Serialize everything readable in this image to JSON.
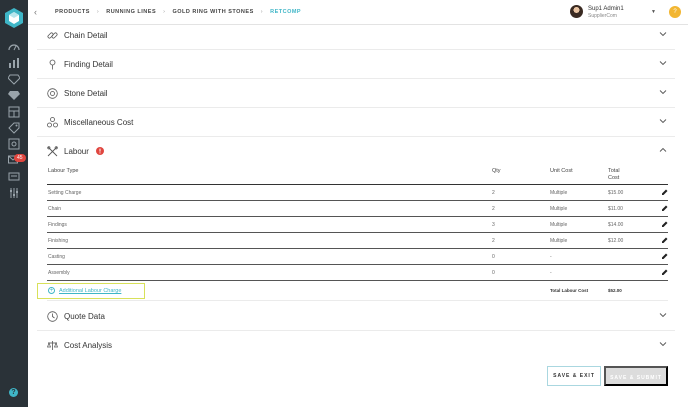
{
  "breadcrumb": {
    "items": [
      "PRODUCTS",
      "RUNNING LINES",
      "GOLD RING WITH STONES",
      "RETCOMP"
    ]
  },
  "user": {
    "name": "Sup1 Admin1",
    "company": "SupplierCom",
    "notification_glyph": "?"
  },
  "sidebar": {
    "badge_count": "45",
    "icons": [
      "dashboard-icon",
      "reports-icon",
      "catalog-icon",
      "gem-icon",
      "layers-icon",
      "tags-icon",
      "box-icon",
      "mail-icon",
      "message-icon",
      "settings-icon"
    ]
  },
  "sections": {
    "chain": "Chain Detail",
    "finding": "Finding Detail",
    "stone": "Stone Detail",
    "misc": "Miscellaneous Cost",
    "labour": "Labour",
    "quote": "Quote Data",
    "cost": "Cost Analysis"
  },
  "labour_table": {
    "headers": {
      "type": "Labour Type",
      "qty": "Qty",
      "unit_cost": "Unit Cost",
      "total_cost": "Total Cost"
    },
    "rows": [
      {
        "type": "Setting Charge",
        "qty": "2",
        "unit": "Multiple",
        "total": "$15.00"
      },
      {
        "type": "Chain",
        "qty": "2",
        "unit": "Multiple",
        "total": "$11.00"
      },
      {
        "type": "Findings",
        "qty": "3",
        "unit": "Multiple",
        "total": "$14.00"
      },
      {
        "type": "Finishing",
        "qty": "2",
        "unit": "Multiple",
        "total": "$12.00"
      },
      {
        "type": "Casting",
        "qty": "0",
        "unit": "-",
        "total": ""
      },
      {
        "type": "Assembly",
        "qty": "0",
        "unit": "-",
        "total": ""
      }
    ],
    "add_label": "Additional Labour Charge",
    "total_label": "Total Labour Cost",
    "total_value": "$52.00"
  },
  "actions": {
    "save_exit": "SAVE & EXIT",
    "save_submit": "SAVE & SUBMIT"
  },
  "colors": {
    "sidebar_bg": "#2a3238",
    "accent": "#3fb6c7",
    "alert": "#e0463f",
    "highlight_border": "#d8e15a"
  }
}
